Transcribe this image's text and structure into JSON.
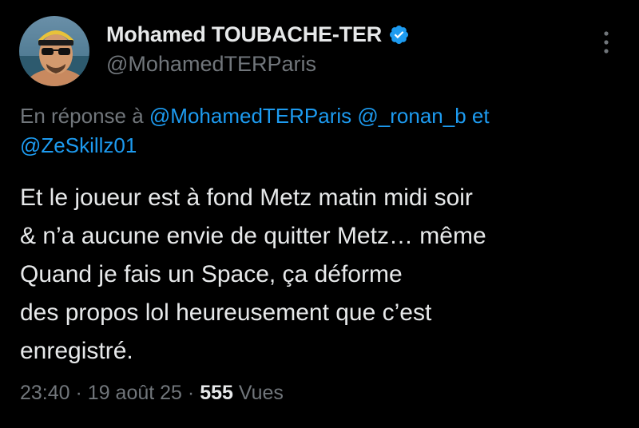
{
  "author": {
    "display_name": "Mohamed TOUBACHE-TER",
    "handle": "@MohamedTERParis",
    "verified": true,
    "avatar": "profile-photo"
  },
  "reply_context": {
    "prefix": "En réponse à",
    "mention_1": "@MohamedTERParis",
    "mention_2": "@_ronan_b",
    "conjunction": "et",
    "mention_3": "@ZeSkillz01"
  },
  "tweet": {
    "lines": [
      "Et le joueur est à fond Metz matin midi soir",
      "& n’a aucune envie de quitter Metz… même",
      "Quand je fais un Space, ça déforme",
      "des propos lol heureusement que c’est",
      "enregistré."
    ]
  },
  "meta": {
    "time": "23:40",
    "separator": "·",
    "date": "19 août 25",
    "views_count": "555",
    "views_label": "Vues"
  },
  "icons": {
    "verified": "verified-badge-icon",
    "more": "more-options-icon"
  },
  "colors": {
    "background": "#000000",
    "text": "#e7e9ea",
    "secondary": "#71767b",
    "accent": "#1d9bf0"
  }
}
